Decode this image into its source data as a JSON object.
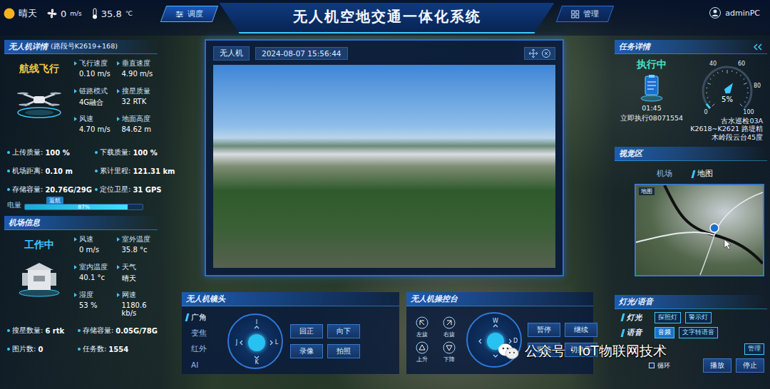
{
  "header": {
    "weather": "晴天",
    "wind": "0",
    "wind_unit": "m/s",
    "temp": "35.8",
    "temp_unit": "℃",
    "title": "无人机空地交通一体化系统",
    "tabs": [
      {
        "label": "调度",
        "selected": true
      },
      {
        "label": "管理",
        "selected": false
      }
    ],
    "user": "adminPC"
  },
  "drone": {
    "title": "无人机详情",
    "road": "(路段号K2619+168)",
    "mode": "航线飞行",
    "stats": [
      {
        "label": "飞行速度",
        "value": "0.10 m/s"
      },
      {
        "label": "垂直速度",
        "value": "4.90 m/s"
      },
      {
        "label": "链路模式",
        "value": "4G融合"
      },
      {
        "label": "搜星质量",
        "value": "32 RTK"
      },
      {
        "label": "风速",
        "value": "4.70 m/s"
      },
      {
        "label": "地面高度",
        "value": "84.62 m"
      }
    ],
    "list": [
      {
        "label": "上传质量:",
        "value": "100 %"
      },
      {
        "label": "下载质量:",
        "value": "100 %"
      },
      {
        "label": "机场距离:",
        "value": "0.10 m"
      },
      {
        "label": "累计里程:",
        "value": "121.31 km"
      },
      {
        "label": "存储容量:",
        "value": "20.76G/29G"
      },
      {
        "label": "定位卫星:",
        "value": "31 GPS"
      }
    ],
    "battery": {
      "label": "电量",
      "badge": "返航",
      "reading": "87%",
      "level": 0.87
    }
  },
  "dock": {
    "title": "机场信息",
    "status": "工作中",
    "stats": [
      {
        "label": "风速",
        "value": "0 m/s"
      },
      {
        "label": "室外温度",
        "value": "35.8 °c"
      },
      {
        "label": "室内温度",
        "value": "40.1 °c"
      },
      {
        "label": "天气",
        "value": "晴天"
      },
      {
        "label": "湿度",
        "value": "53 %"
      },
      {
        "label": "网速",
        "value": "1180.6 kb/s"
      }
    ],
    "list": [
      {
        "label": "搜星数量:",
        "value": "6 rtk"
      },
      {
        "label": "存储容量:",
        "value": "0.05G/78G"
      },
      {
        "label": "图片数:",
        "value": "0"
      },
      {
        "label": "任务数:",
        "value": "1554"
      }
    ]
  },
  "video": {
    "source": "无人机",
    "time": "2024-08-07 15:56:44"
  },
  "camera": {
    "title": "无人机镜头",
    "modes": [
      {
        "label": "广角",
        "selected": true
      },
      {
        "label": "变焦",
        "selected": false
      },
      {
        "label": "红外",
        "selected": false
      },
      {
        "label": "AI",
        "selected": false
      }
    ],
    "keys": [
      {
        "label": "I",
        "pos": "up"
      },
      {
        "label": "J",
        "pos": "left"
      },
      {
        "label": "L",
        "pos": "right"
      },
      {
        "label": "K",
        "pos": "down"
      }
    ],
    "buttons": [
      "回正",
      "向下",
      "录像",
      "拍照"
    ]
  },
  "console": {
    "title": "无人机操控台",
    "rotations": [
      "左旋",
      "右旋",
      "上升",
      "下降"
    ],
    "keys": [
      {
        "label": "W",
        "pos": "up"
      },
      {
        "label": "D",
        "pos": "right"
      }
    ],
    "buttons": [
      "暂停",
      "继续",
      "返航",
      "切换手"
    ]
  },
  "task": {
    "title": "任务详情",
    "status": "执行中",
    "timer": "01:45",
    "exec": "立即执行08071554",
    "gauge": {
      "ticks": [
        "0",
        "40",
        "60",
        "80",
        "100"
      ],
      "reading": "5%",
      "level": 0.05
    },
    "lines": [
      "古水巡检03A",
      "K2618~K2621 路堤精",
      "木岭段云台45度"
    ]
  },
  "view": {
    "title": "视觉区",
    "tabs": [
      {
        "label": "机场",
        "selected": false
      },
      {
        "label": "地图",
        "selected": true
      }
    ],
    "map_label": "地图"
  },
  "lights": {
    "title": "灯光/语音",
    "light_label": "灯光",
    "lights": [
      "探照灯",
      "警示灯"
    ],
    "voice_label": "语音",
    "voices": [
      {
        "label": "音频",
        "selected": true
      },
      {
        "label": "文字转语音",
        "selected": false
      }
    ],
    "extra": "管理",
    "loop": {
      "label": "循环",
      "checked": false
    },
    "buttons": [
      "播放",
      "停止"
    ]
  },
  "watermark": "公众号 · IoT物联网技术"
}
